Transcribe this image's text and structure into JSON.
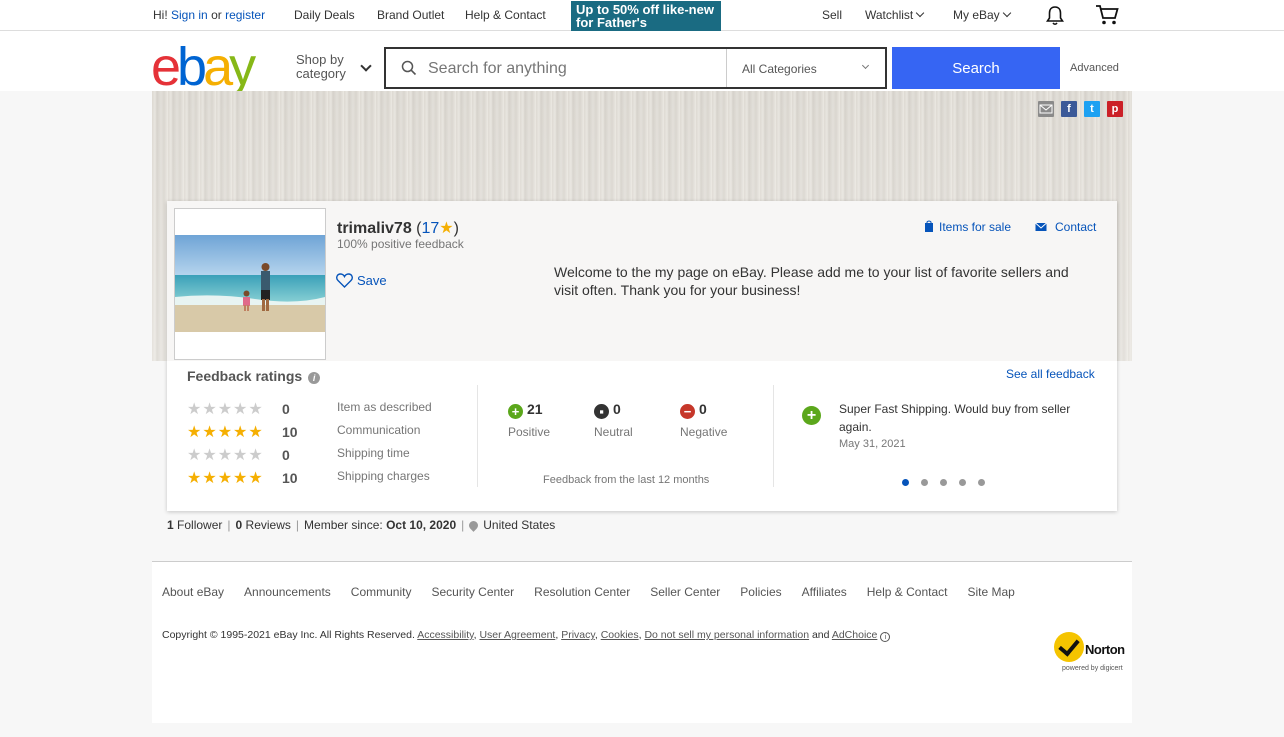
{
  "topbar": {
    "hi": "Hi!",
    "signin": "Sign in",
    "or": "or",
    "register": "register",
    "daily_deals": "Daily Deals",
    "brand_outlet": "Brand Outlet",
    "help_contact": "Help & Contact",
    "promo_line1": "Up to 50% off like-new",
    "promo_line2": "for Father's",
    "sell": "Sell",
    "watchlist": "Watchlist",
    "my_ebay": "My eBay"
  },
  "header": {
    "logo": [
      "e",
      "b",
      "a",
      "y"
    ],
    "shop_by_line1": "Shop by",
    "shop_by_line2": "category",
    "search_placeholder": "Search for anything",
    "category_selected": "All Categories",
    "search_button": "Search",
    "advanced": "Advanced"
  },
  "profile": {
    "username": "trimaliv78",
    "score": "17",
    "positive_feedback": "100% positive feedback",
    "save": "Save",
    "welcome": "Welcome to the my page on eBay. Please add me to your list of favorite sellers and visit often. Thank you for your business!",
    "items_for_sale": "Items for sale",
    "contact": "Contact"
  },
  "feedback": {
    "title": "Feedback ratings",
    "see_all": "See all feedback",
    "ratings": [
      {
        "stars": 0,
        "value": "0",
        "label": "Item as described"
      },
      {
        "stars": 5,
        "value": "10",
        "label": "Communication"
      },
      {
        "stars": 0,
        "value": "0",
        "label": "Shipping time"
      },
      {
        "stars": 5,
        "value": "10",
        "label": "Shipping charges"
      }
    ],
    "counts": [
      {
        "value": "21",
        "label": "Positive",
        "color": "#5ba71b"
      },
      {
        "value": "0",
        "label": "Neutral",
        "color": "#333333"
      },
      {
        "value": "0",
        "label": "Negative",
        "color": "#c6372a"
      }
    ],
    "last12": "Feedback from the last 12 months",
    "comment": "Super Fast Shipping. Would buy from seller again.",
    "comment_date": "May 31, 2021",
    "carousel_pages": 5,
    "carousel_active": 1
  },
  "stats": {
    "followers_num": "1",
    "followers": "Follower",
    "reviews_num": "0",
    "reviews": "Reviews",
    "member_since_label": "Member since:",
    "member_since": "Oct 10, 2020",
    "location": "United States"
  },
  "footer": {
    "links": [
      "About eBay",
      "Announcements",
      "Community",
      "Security Center",
      "Resolution Center",
      "Seller Center",
      "Policies",
      "Affiliates",
      "Help & Contact",
      "Site Map"
    ],
    "copyright": "Copyright © 1995-2021 eBay Inc. All Rights Reserved.",
    "legal_links": [
      "Accessibility",
      "User Agreement",
      "Privacy",
      "Cookies",
      "Do not sell my personal information"
    ],
    "and": "and",
    "adchoice": "AdChoice",
    "norton": "Norton",
    "norton_sub": "powered by digicert"
  },
  "colors": {
    "accent": "#0654ba",
    "search_button": "#3665f3",
    "star": "#f5af02"
  }
}
